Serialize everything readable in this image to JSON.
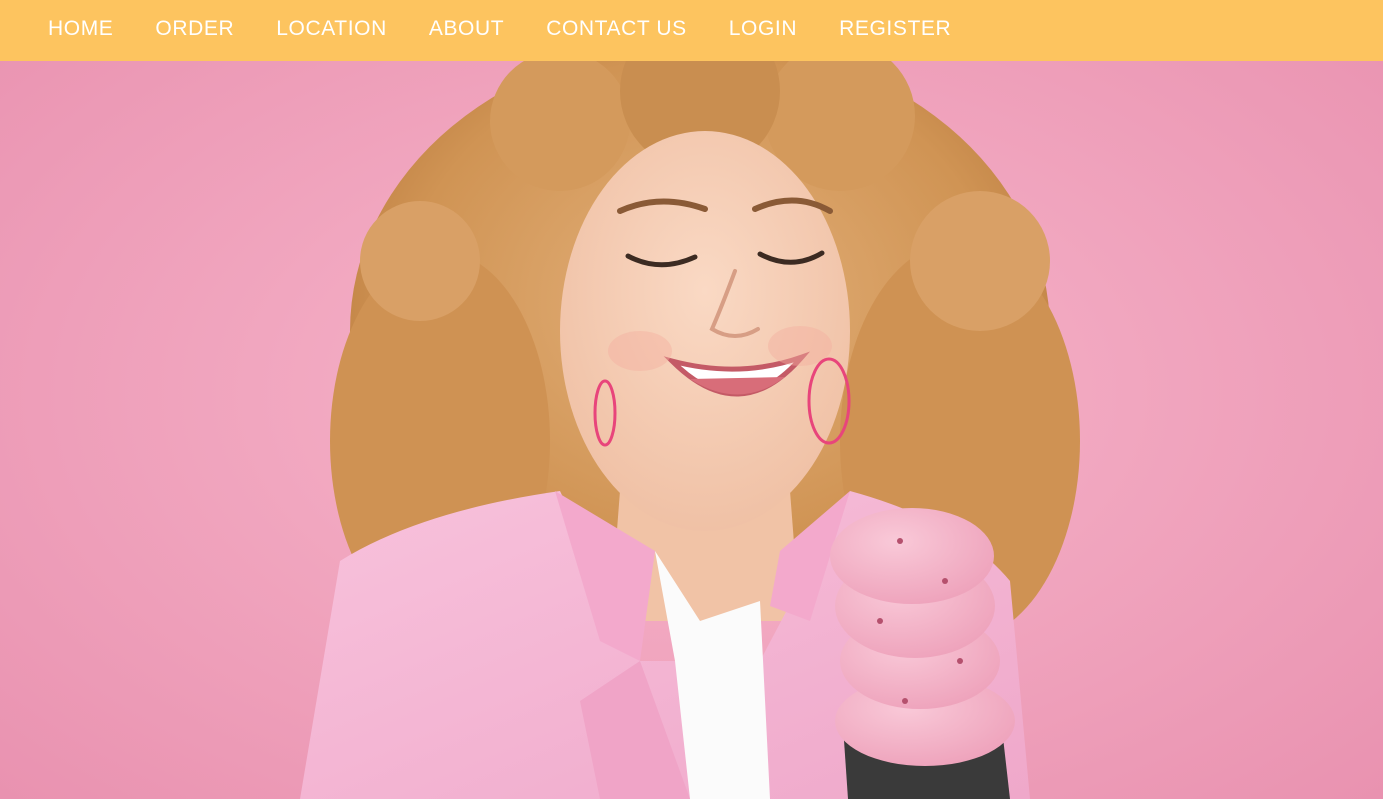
{
  "nav": {
    "items": [
      {
        "label": "HOME"
      },
      {
        "label": "ORDER"
      },
      {
        "label": "LOCATION"
      },
      {
        "label": "ABOUT"
      },
      {
        "label": "CONTACT US"
      },
      {
        "label": "LOGIN"
      },
      {
        "label": "REGISTER"
      }
    ]
  },
  "colors": {
    "nav_background": "#fdc45f",
    "nav_text": "#ffffff",
    "hero_background": "#f1a6bf",
    "jacket": "#f5b5d2",
    "hair": "#d49a5c",
    "skin": "#f5cdb4",
    "ice_cream": "#f4b3c8",
    "cone": "#3a3a3a"
  },
  "hero": {
    "image_subject": "smiling-woman-with-ice-cream-cone"
  }
}
